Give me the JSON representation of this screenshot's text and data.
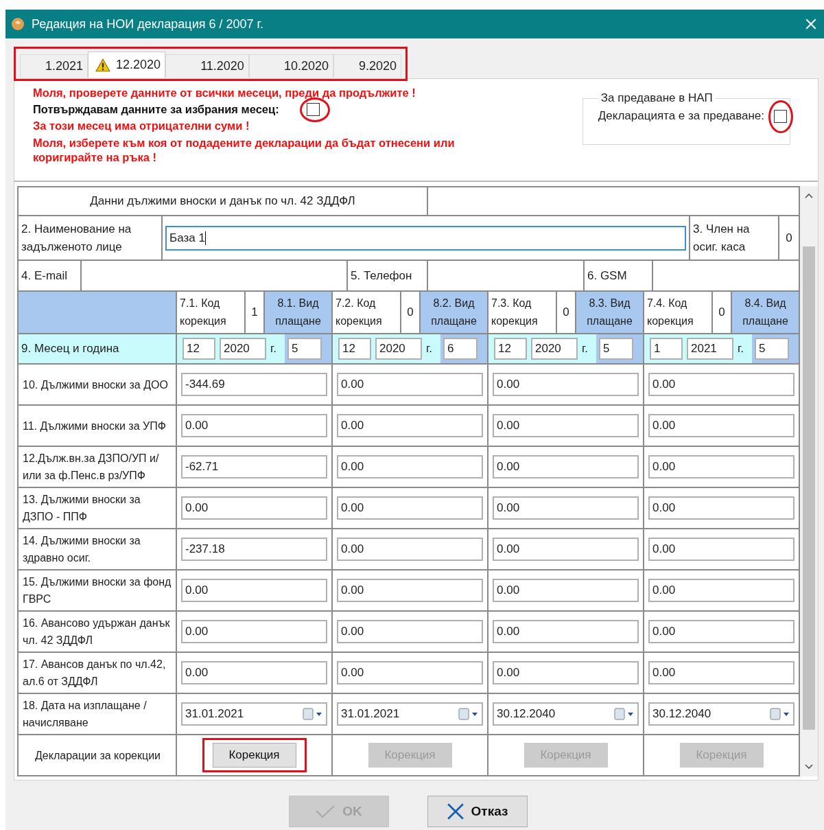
{
  "window": {
    "title": "Редакция на НОИ декларация 6 / 2007 г."
  },
  "tabs": [
    {
      "label": "1.2021",
      "selected": false,
      "warning": false
    },
    {
      "label": "12.2020",
      "selected": true,
      "warning": true
    },
    {
      "label": "11.2020",
      "selected": false,
      "warning": false
    },
    {
      "label": "10.2020",
      "selected": false,
      "warning": false
    },
    {
      "label": "9.2020",
      "selected": false,
      "warning": false
    }
  ],
  "notices": [
    {
      "kind": "error",
      "text": "Моля, проверете данните от всички месеци, преди да продължите !"
    },
    {
      "kind": "confirm",
      "text": "Потвърждавам данните за избрания месец:",
      "checked": false
    },
    {
      "kind": "error",
      "text": "За този месец има отрицателни суми !"
    },
    {
      "kind": "error",
      "text": "Моля, изберете към коя от подадените декларации да бъдат отнесени или коригирайте на ръка !"
    }
  ],
  "nap_group": {
    "title": "За предаване в НАП",
    "label": "Декларацията е за предаване:",
    "checked": false
  },
  "form": {
    "section_title": "Данни дължими вноски и данък по чл. 42 ЗДДФЛ",
    "name_label": "2. Наименование на задълженото лице",
    "name_value": "База 1",
    "member_label": "3. Член на осиг. каса",
    "member_value": "0",
    "email_label": "4. E-mail",
    "phone_label": "5. Телефон",
    "gsm_label": "6. GSM",
    "month_label": "9. Месец и година",
    "date_label": "18. Дата на изплащане / начисляване",
    "declarations_label": "Декларации за корекции"
  },
  "row_labels": [
    "10. Дължими вноски за ДОО",
    "11. Дължими вноски за УПФ",
    "12.Дълж.вн.за ДЗПО/УП и/или за ф.Пенс.в рз/УПФ",
    "13. Дължими вноски за ДЗПО - ППФ",
    "14. Дължими вноски за здравно осиг.",
    "15. Дължими вноски за фонд ГВРС",
    "16. Авансово удържан данък чл. 42 ЗДДФЛ",
    "17. Авансов данък по чл.42, ал.6 от ЗДДФЛ"
  ],
  "periods": [
    {
      "code_label": "7.1. Код корекция",
      "code_value": "1",
      "type_label": "8.1. Вид плащане",
      "month": "12",
      "year": "2020",
      "year_suffix": "г.",
      "type_value": "5",
      "amounts": [
        "-344.69",
        "0.00",
        "-62.71",
        "0.00",
        "-237.18",
        "0.00",
        "0.00",
        "0.00"
      ],
      "date": "31.01.2021",
      "button": {
        "label": "Корекция",
        "disabled": false
      }
    },
    {
      "code_label": "7.2. Код корекция",
      "code_value": "0",
      "type_label": "8.2. Вид плащане",
      "month": "12",
      "year": "2020",
      "year_suffix": "г.",
      "type_value": "6",
      "amounts": [
        "0.00",
        "0.00",
        "0.00",
        "0.00",
        "0.00",
        "0.00",
        "0.00",
        "0.00"
      ],
      "date": "31.01.2021",
      "button": {
        "label": "Корекция",
        "disabled": true
      }
    },
    {
      "code_label": "7.3. Код корекция",
      "code_value": "0",
      "type_label": "8.3. Вид плащане",
      "month": "12",
      "year": "2020",
      "year_suffix": "г.",
      "type_value": "5",
      "amounts": [
        "0.00",
        "0.00",
        "0.00",
        "0.00",
        "0.00",
        "0.00",
        "0.00",
        "0.00"
      ],
      "date": "30.12.2040",
      "button": {
        "label": "Корекция",
        "disabled": true
      }
    },
    {
      "code_label": "7.4. Код корекция",
      "code_value": "0",
      "type_label": "8.4. Вид плащане",
      "month": "1",
      "year": "2021",
      "year_suffix": "г.",
      "type_value": "5",
      "amounts": [
        "0.00",
        "0.00",
        "0.00",
        "0.00",
        "0.00",
        "0.00",
        "0.00",
        "0.00"
      ],
      "date": "30.12.2040",
      "button": {
        "label": "Корекция",
        "disabled": true
      }
    }
  ],
  "buttons": [
    {
      "kind": "ok",
      "label": "OK",
      "disabled": true
    },
    {
      "kind": "cancel",
      "label": "Отказ",
      "disabled": false
    }
  ]
}
